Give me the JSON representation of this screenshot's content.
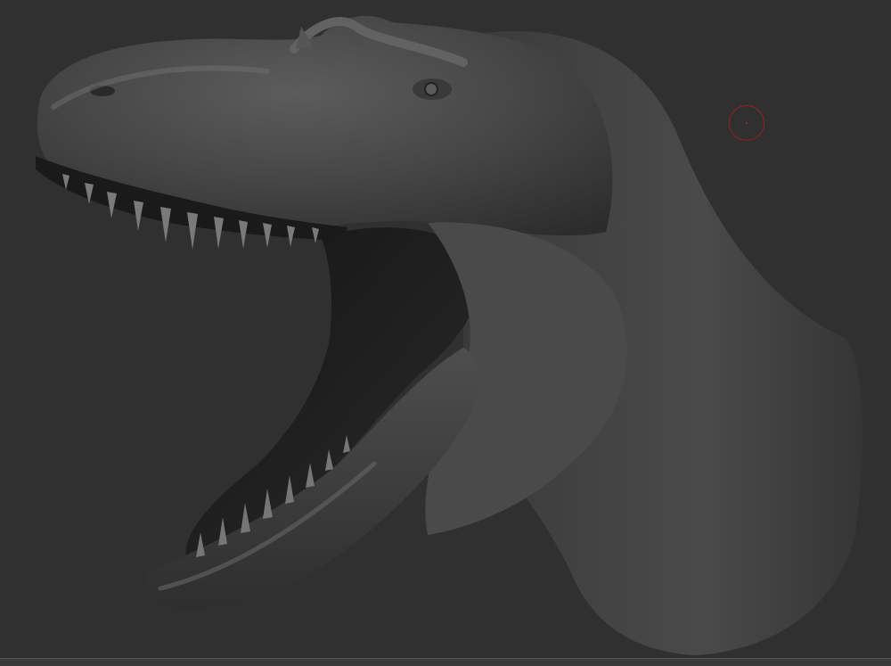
{
  "viewport": {
    "background": "#303030",
    "model": "trex-head-sculpt",
    "material_base": "#4a4a4a",
    "material_highlight": "#6a6a6a",
    "material_shadow": "#1c1c1c"
  },
  "cursor": {
    "icon": "brush-circle-icon",
    "color": "#9a2020"
  }
}
